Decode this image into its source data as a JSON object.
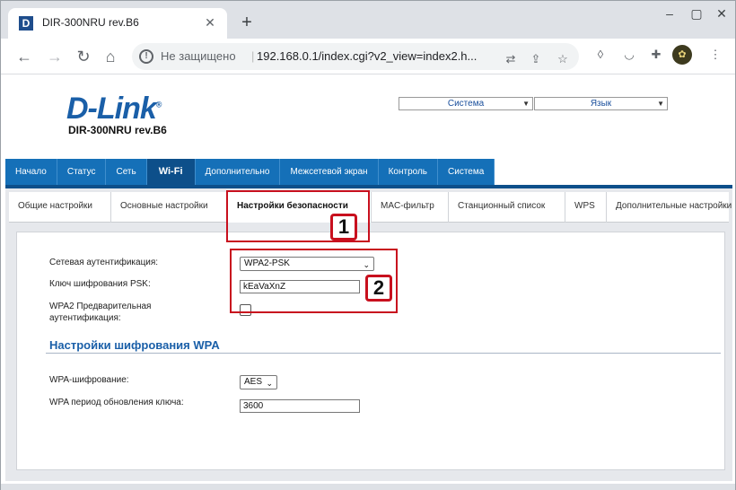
{
  "browser": {
    "tab_title": "DIR-300NRU rev.B6",
    "tab_favicon_letter": "D",
    "new_tab_symbol": "+",
    "not_secure_text": "Не защищено",
    "url": "192.168.0.1/index.cgi?v2_view=index2.h...",
    "window_buttons": [
      "–",
      "▢",
      "✕"
    ]
  },
  "router": {
    "logo_text": "D-Link",
    "logo_mark": "®",
    "model": "DIR-300NRU rev.B6",
    "system_select": "Система",
    "language_select": "Язык"
  },
  "main_menu": [
    {
      "label": "Начало",
      "active": false
    },
    {
      "label": "Статус",
      "active": false
    },
    {
      "label": "Сеть",
      "active": false
    },
    {
      "label": "Wi-Fi",
      "active": true
    },
    {
      "label": "Дополнительно",
      "active": false
    },
    {
      "label": "Межсетевой экран",
      "active": false
    },
    {
      "label": "Контроль",
      "active": false
    },
    {
      "label": "Система",
      "active": false
    }
  ],
  "sub_tabs": [
    {
      "label": "Общие настройки"
    },
    {
      "label": "Основные настройки"
    },
    {
      "label": "Настройки безопасности"
    },
    {
      "label": "MAC-фильтр"
    },
    {
      "label": "Станционный список"
    },
    {
      "label": "WPS"
    },
    {
      "label": "Дополнительные настройки"
    }
  ],
  "form": {
    "auth_label": "Сетевая аутентификация:",
    "auth_value": "WPA2-PSK",
    "psk_label": "Ключ шифрования PSK:",
    "psk_value": "kEaVaXnZ",
    "preauth_label_1": "WPA2 Предварительная",
    "preauth_label_2": "аутентификация:",
    "preauth_checked": false,
    "wpa_section_title": "Настройки шифрования WPA",
    "wpa_enc_label": "WPA-шифрование:",
    "wpa_enc_value": "AES",
    "wpa_period_label": "WPA период обновления ключа:",
    "wpa_period_value": "3600"
  },
  "annotations": {
    "marker_1": "1",
    "marker_2": "2",
    "color": "#c8101e"
  }
}
